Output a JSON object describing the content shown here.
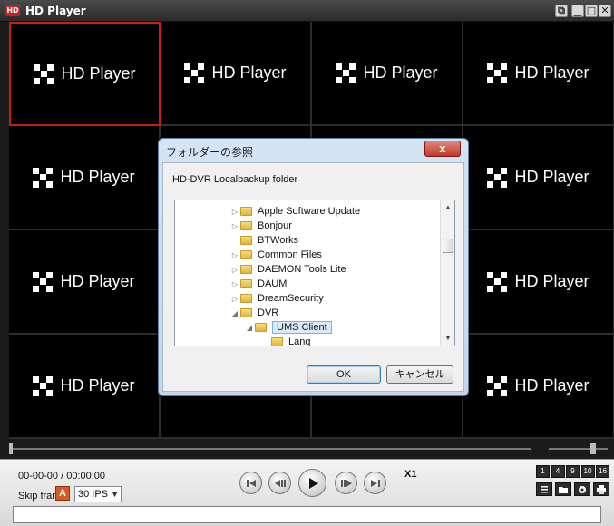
{
  "window": {
    "title": "HD Player",
    "app_icon": "HD"
  },
  "grid": {
    "cell_label": "HD Player",
    "rows": 4,
    "cols": 4,
    "selected_cell": 0,
    "selected_border_color": "#d01a1a"
  },
  "dialog": {
    "title": "フォルダーの参照",
    "description": "HD-DVR Localbackup folder",
    "tree_items": [
      {
        "label": "Apple Software Update",
        "expandable": true
      },
      {
        "label": "Bonjour",
        "expandable": true
      },
      {
        "label": "BTWorks",
        "expandable": false
      },
      {
        "label": "Common Files",
        "expandable": true
      },
      {
        "label": "DAEMON Tools Lite",
        "expandable": true
      },
      {
        "label": "DAUM",
        "expandable": true
      },
      {
        "label": "DreamSecurity",
        "expandable": true
      },
      {
        "label": "DVR",
        "expandable": true,
        "expanded": true
      },
      {
        "label": "UMS Client",
        "expandable": true,
        "expanded": true,
        "selected": true
      },
      {
        "label": "Lang",
        "expandable": false
      }
    ],
    "ok_label": "OK",
    "cancel_label": "キャンセル"
  },
  "controls": {
    "time": "00-00-00 / 00:00:00",
    "skip_label": "Skip frame",
    "skip_mode_badge": "A",
    "fps_value": "30 IPS",
    "speed": "X1",
    "layout_options": [
      "1",
      "4",
      "9",
      "10",
      "16"
    ],
    "tool_icons": [
      "list-icon",
      "open-folder-icon",
      "settings-icon",
      "print-icon"
    ],
    "seek_position": 0,
    "volume_level": 0.75
  }
}
